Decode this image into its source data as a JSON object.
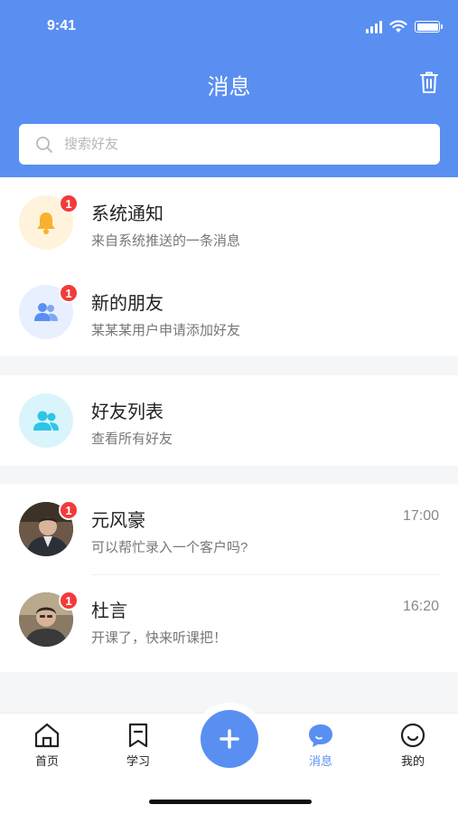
{
  "status": {
    "time": "9:41"
  },
  "header": {
    "title": "消息"
  },
  "search": {
    "placeholder": "搜索好友"
  },
  "system_items": [
    {
      "title": "系统通知",
      "subtitle": "来自系统推送的一条消息",
      "badge": "1",
      "icon": "bell-icon"
    },
    {
      "title": "新的朋友",
      "subtitle": "某某某用户申请添加好友",
      "badge": "1",
      "icon": "users-icon"
    }
  ],
  "friends_list": {
    "title": "好友列表",
    "subtitle": "查看所有好友",
    "icon": "group-icon"
  },
  "chats": [
    {
      "name": "元风豪",
      "message": "可以帮忙录入一个客户吗?",
      "time": "17:00",
      "badge": "1"
    },
    {
      "name": "杜言",
      "message": "开课了，快来听课把！",
      "time": "16:20",
      "badge": "1"
    }
  ],
  "tabbar": {
    "home": "首页",
    "study": "学习",
    "messages": "消息",
    "mine": "我的",
    "active": "messages"
  },
  "colors": {
    "brand": "#5a8ff2",
    "badge": "#f23b3b",
    "bell_bg": "#fff3dc",
    "bell": "#f7b12d",
    "users_bg": "#e8efff",
    "group_bg": "#d9f5fb",
    "group": "#2ec5e6"
  }
}
